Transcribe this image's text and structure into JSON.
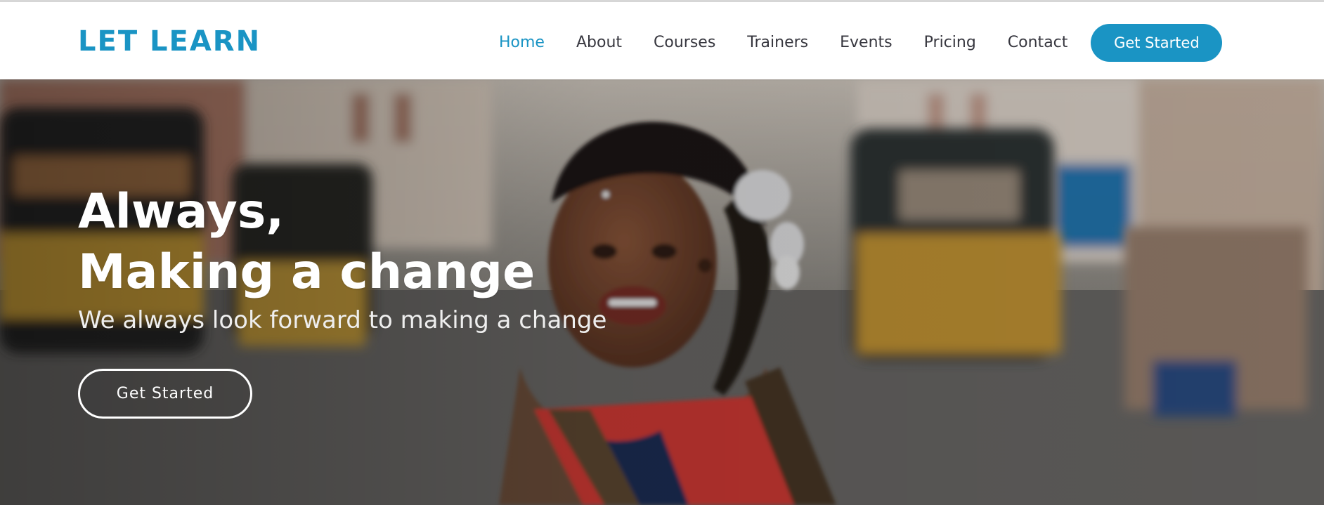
{
  "brand": {
    "logo_text": "LET LEARN",
    "accent_color": "#1a94c4"
  },
  "nav": {
    "items": [
      {
        "label": "Home",
        "active": true
      },
      {
        "label": "About",
        "active": false
      },
      {
        "label": "Courses",
        "active": false
      },
      {
        "label": "Trainers",
        "active": false
      },
      {
        "label": "Events",
        "active": false
      },
      {
        "label": "Pricing",
        "active": false
      },
      {
        "label": "Contact",
        "active": false
      }
    ],
    "cta_label": "Get Started"
  },
  "hero": {
    "title_line_1": "Always,",
    "title_line_2": "Making a change",
    "subtitle": "We always look forward to making a change",
    "cta_label": "Get Started"
  }
}
